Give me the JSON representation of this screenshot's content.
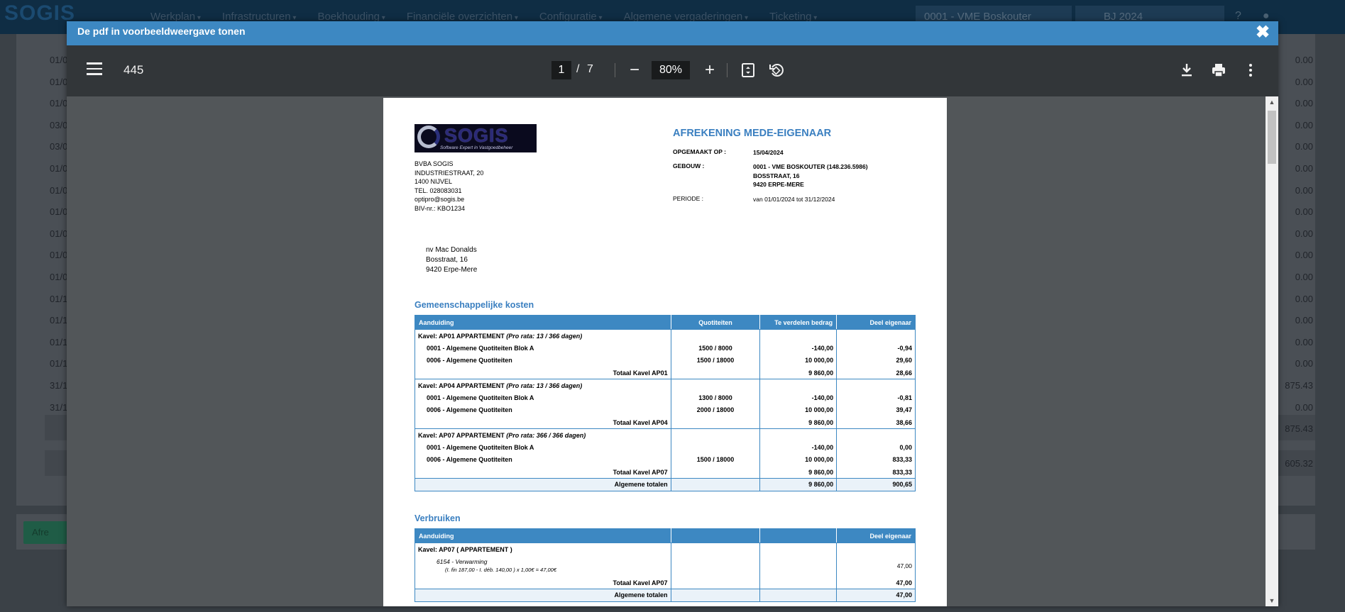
{
  "background": {
    "logo": "SOGIS",
    "nav": [
      "Werkplan",
      "Infrastructuren",
      "Boekhouding",
      "Financiële overzichten",
      "Configuratie",
      "Algemene vergaderingen",
      "Ticketing"
    ],
    "vme_selector": "0001 - VME Boskouter",
    "bj_selector": "BJ 2024",
    "dates": [
      "01/0",
      "01/0",
      "01/0",
      "03/0",
      "03/0",
      "01/0",
      "01/0",
      "01/0",
      "01/0",
      "01/0",
      "01/0",
      "01/1",
      "01/1",
      "01/1",
      "01/1",
      "31/1",
      "31/1"
    ],
    "amounts": [
      "0.00",
      "0.00",
      "0.00",
      "0.00",
      "0.00",
      "0.00",
      "0.00",
      "0.00",
      "0.00",
      "0.00",
      "0.00",
      "0.00",
      "0.00",
      "0.00",
      "0.00",
      "875.43",
      "0.00"
    ],
    "total1": "875.43",
    "total2": "605.32",
    "afrek_button": "Afre"
  },
  "modal": {
    "title": "De pdf in voorbeeldweergave tonen",
    "close_icon": "close-icon"
  },
  "toolbar": {
    "doc_name": "445",
    "page_current": "1",
    "page_sep": "/",
    "page_total": "7",
    "zoom": "80%"
  },
  "pdf": {
    "logo_text": "SOGIS",
    "logo_tagline": "Software Expert in Vastgoedbeheer",
    "sender": [
      "BVBA SOGIS",
      "INDUSTRIESTRAAT, 20",
      "1400 NIJVEL",
      "TEL. 028083031",
      "optipro@sogis.be",
      "BIV-nr.: KBO1234"
    ],
    "title": "AFREKENING MEDE-EIGENAAR",
    "opgemaakt_label": "OPGEMAAKT OP :",
    "opgemaakt_value": "15/04/2024",
    "gebouw_label": "GEBOUW :",
    "gebouw_lines": [
      "0001 - VME BOSKOUTER (148.236.5986)",
      "BOSSTRAAT, 16",
      "9420 ERPE-MERE"
    ],
    "periode_label": "PERIODE :",
    "periode_value": "van 01/01/2024 tot 31/12/2024",
    "recipient": [
      "nv Mac Donalds",
      "Bosstraat, 16",
      "9420 Erpe-Mere"
    ],
    "section1_title": "Gemeenschappelijke kosten",
    "table1_headers": [
      "Aanduiding",
      "Quotiteiten",
      "Te verdelen bedrag",
      "Deel eigenaar"
    ],
    "kavels": [
      {
        "title": "Kavel: AP01 APPARTEMENT",
        "prorata": "(Pro rata: 13 / 366 dagen)",
        "lines": [
          {
            "name": "0001 - Algemene Quotiteiten Blok A",
            "quot": "1500 / 8000",
            "bedrag": "-140,00",
            "deel": "-0,94"
          },
          {
            "name": "0006 - Algemene Quotiteiten",
            "quot": "1500 / 18000",
            "bedrag": "10 000,00",
            "deel": "29,60"
          }
        ],
        "total_label": "Totaal Kavel AP01",
        "total_bedrag": "9 860,00",
        "total_deel": "28,66"
      },
      {
        "title": "Kavel: AP04 APPARTEMENT",
        "prorata": "(Pro rata: 13 / 366 dagen)",
        "lines": [
          {
            "name": "0001 - Algemene Quotiteiten Blok A",
            "quot": "1300 / 8000",
            "bedrag": "-140,00",
            "deel": "-0,81"
          },
          {
            "name": "0006 - Algemene Quotiteiten",
            "quot": "2000 / 18000",
            "bedrag": "10 000,00",
            "deel": "39,47"
          }
        ],
        "total_label": "Totaal Kavel AP04",
        "total_bedrag": "9 860,00",
        "total_deel": "38,66"
      },
      {
        "title": "Kavel: AP07 APPARTEMENT",
        "prorata": "(Pro rata: 366 / 366 dagen)",
        "lines": [
          {
            "name": "0001 - Algemene Quotiteiten Blok A",
            "quot": "",
            "bedrag": "-140,00",
            "deel": "0,00"
          },
          {
            "name": "0006 - Algemene Quotiteiten",
            "quot": "1500 / 18000",
            "bedrag": "10 000,00",
            "deel": "833,33"
          }
        ],
        "total_label": "Totaal Kavel AP07",
        "total_bedrag": "9 860,00",
        "total_deel": "833,33"
      }
    ],
    "grand_label": "Algemene totalen",
    "grand_bedrag": "9 860,00",
    "grand_deel": "900,65",
    "section2_title": "Verbruiken",
    "table2_headers": [
      "Aanduiding",
      "",
      "",
      "Deel eigenaar"
    ],
    "verbruik_kavel": "Kavel: AP07 ( APPARTEMENT )",
    "verbruik_line": "6154 - Verwarming",
    "verbruik_detail": "(I. fin 187,00 - I. déb. 140,00 ) x 1,00€ = 47,00€",
    "verbruik_amount": "47,00",
    "verbruik_total_label": "Totaal Kavel AP07",
    "verbruik_total": "47,00",
    "verbruik_grand_label": "Algemene totalen",
    "verbruik_grand": "47,00"
  }
}
